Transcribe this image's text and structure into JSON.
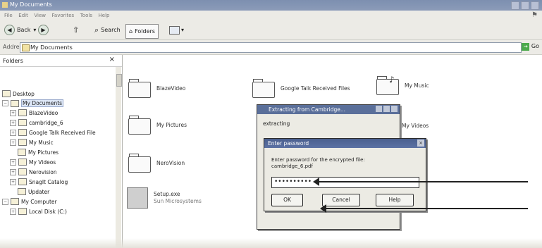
{
  "window": {
    "title": "My Documents"
  },
  "menu": [
    "File",
    "Edit",
    "View",
    "Favorites",
    "Tools",
    "Help"
  ],
  "toolbar": {
    "back_label": "Back",
    "search_label": "Search",
    "folders_label": "Folders"
  },
  "address": {
    "label": "Address",
    "value": "My Documents",
    "go_label": "Go"
  },
  "sidebar": {
    "header": "Folders",
    "items": [
      {
        "label": "Desktop"
      },
      {
        "label": "My Documents"
      },
      {
        "label": "BlazeVideo"
      },
      {
        "label": "cambridge_6"
      },
      {
        "label": "Google Talk Received File"
      },
      {
        "label": "My Music"
      },
      {
        "label": "My Pictures"
      },
      {
        "label": "My Videos"
      },
      {
        "label": "Nerovision"
      },
      {
        "label": "SnagIt Catalog"
      },
      {
        "label": "Updater"
      },
      {
        "label": "My Computer"
      },
      {
        "label": "Local Disk (C:)"
      }
    ]
  },
  "content": {
    "items": [
      {
        "label": "BlazeVideo"
      },
      {
        "label": "Google Talk Received Files"
      },
      {
        "label": "My Music"
      },
      {
        "label": "My Pictures"
      },
      {
        "label": "My Videos"
      },
      {
        "label": "NeroVision"
      },
      {
        "label": "Setup.exe",
        "sublabel": "Sun Microsystems"
      }
    ]
  },
  "extract_dialog": {
    "title": "Extracting from Cambridge...",
    "line1": "extracting"
  },
  "password_dialog": {
    "title": "Enter password",
    "message_line1": "Enter password for the encrypted file:",
    "message_line2": "cambridge_6.pdf",
    "password_mask": "••••••••••",
    "ok_label": "OK",
    "cancel_label": "Cancel",
    "help_label": "Help"
  }
}
